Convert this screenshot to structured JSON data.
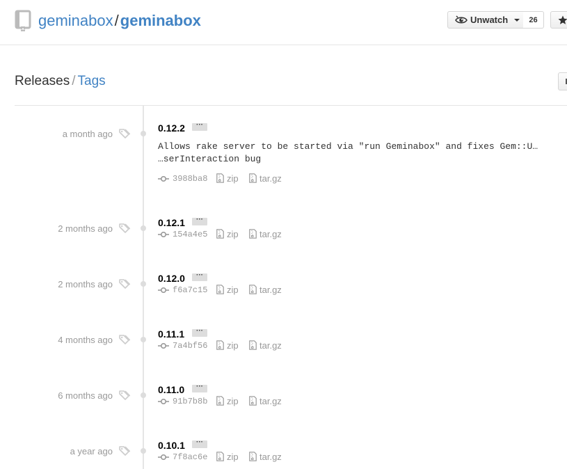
{
  "repo": {
    "owner": "geminabox",
    "separator": "/",
    "name": "geminabox"
  },
  "watch": {
    "label": "Unwatch",
    "count": "26"
  },
  "subnav": {
    "releases": "Releases",
    "separator": "/",
    "tags": "Tags"
  },
  "tags": [
    {
      "date": "a month ago",
      "name": "0.12.2",
      "description": "Allows rake server to be started via \"run Geminabox\" and fixes Gem::U…\n…serInteraction bug",
      "sha": "3988ba8",
      "zip": "zip",
      "targz": "tar.gz"
    },
    {
      "date": "2 months ago",
      "name": "0.12.1",
      "sha": "154a4e5",
      "zip": "zip",
      "targz": "tar.gz"
    },
    {
      "date": "2 months ago",
      "name": "0.12.0",
      "sha": "f6a7c15",
      "zip": "zip",
      "targz": "tar.gz"
    },
    {
      "date": "4 months ago",
      "name": "0.11.1",
      "sha": "7a4bf56",
      "zip": "zip",
      "targz": "tar.gz"
    },
    {
      "date": "6 months ago",
      "name": "0.11.0",
      "sha": "91b7b8b",
      "zip": "zip",
      "targz": "tar.gz"
    },
    {
      "date": "a year ago",
      "name": "0.10.1",
      "sha": "7f8ac6e",
      "zip": "zip",
      "targz": "tar.gz"
    }
  ],
  "ellipsis": "···",
  "colors": {
    "link": "#4183c4",
    "muted": "#999999",
    "border": "#e5e5e5"
  },
  "icons": [
    "repo-icon",
    "eye-icon",
    "star-icon",
    "tag-icon",
    "commit-icon",
    "file-zip-icon"
  ]
}
